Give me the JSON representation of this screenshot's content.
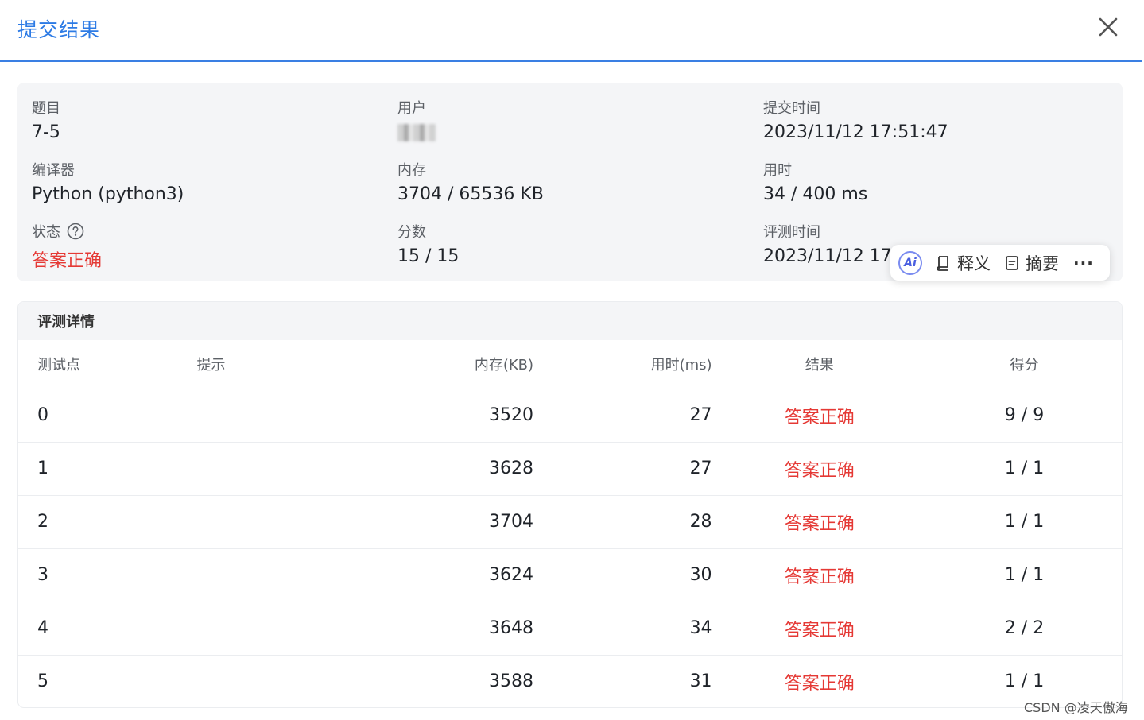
{
  "dialog": {
    "title": "提交结果"
  },
  "summary": {
    "problem": {
      "label": "题目",
      "value": "7-5"
    },
    "user": {
      "label": "用户"
    },
    "submit_time": {
      "label": "提交时间",
      "value": "2023/11/12 17:51:47"
    },
    "compiler": {
      "label": "编译器",
      "value": "Python (python3)"
    },
    "memory": {
      "label": "内存",
      "value": "3704 / 65536 KB"
    },
    "time_used": {
      "label": "用时",
      "value": "34 / 400 ms"
    },
    "status": {
      "label": "状态",
      "value": "答案正确"
    },
    "score": {
      "label": "分数",
      "value": "15 / 15"
    },
    "judge_time": {
      "label": "评测时间",
      "value": "2023/11/12 17:5"
    }
  },
  "ai_toolbar": {
    "badge": "Ai",
    "explain": "释义",
    "summary": "摘要",
    "more": "···"
  },
  "detail": {
    "title": "评测详情",
    "columns": [
      "测试点",
      "提示",
      "内存(KB)",
      "用时(ms)",
      "结果",
      "得分"
    ],
    "rows": [
      {
        "case": "0",
        "hint": "",
        "memory": "3520",
        "time": "27",
        "result": "答案正确",
        "score": "9 / 9"
      },
      {
        "case": "1",
        "hint": "",
        "memory": "3628",
        "time": "27",
        "result": "答案正确",
        "score": "1 / 1"
      },
      {
        "case": "2",
        "hint": "",
        "memory": "3704",
        "time": "28",
        "result": "答案正确",
        "score": "1 / 1"
      },
      {
        "case": "3",
        "hint": "",
        "memory": "3624",
        "time": "30",
        "result": "答案正确",
        "score": "1 / 1"
      },
      {
        "case": "4",
        "hint": "",
        "memory": "3648",
        "time": "34",
        "result": "答案正确",
        "score": "2 / 2"
      },
      {
        "case": "5",
        "hint": "",
        "memory": "3588",
        "time": "31",
        "result": "答案正确",
        "score": "1 / 1"
      }
    ]
  },
  "watermark": "CSDN @凌天傲海",
  "colors": {
    "accent": "#2d7be5",
    "success_text": "#e53935",
    "panel_bg": "#f4f5f7"
  }
}
